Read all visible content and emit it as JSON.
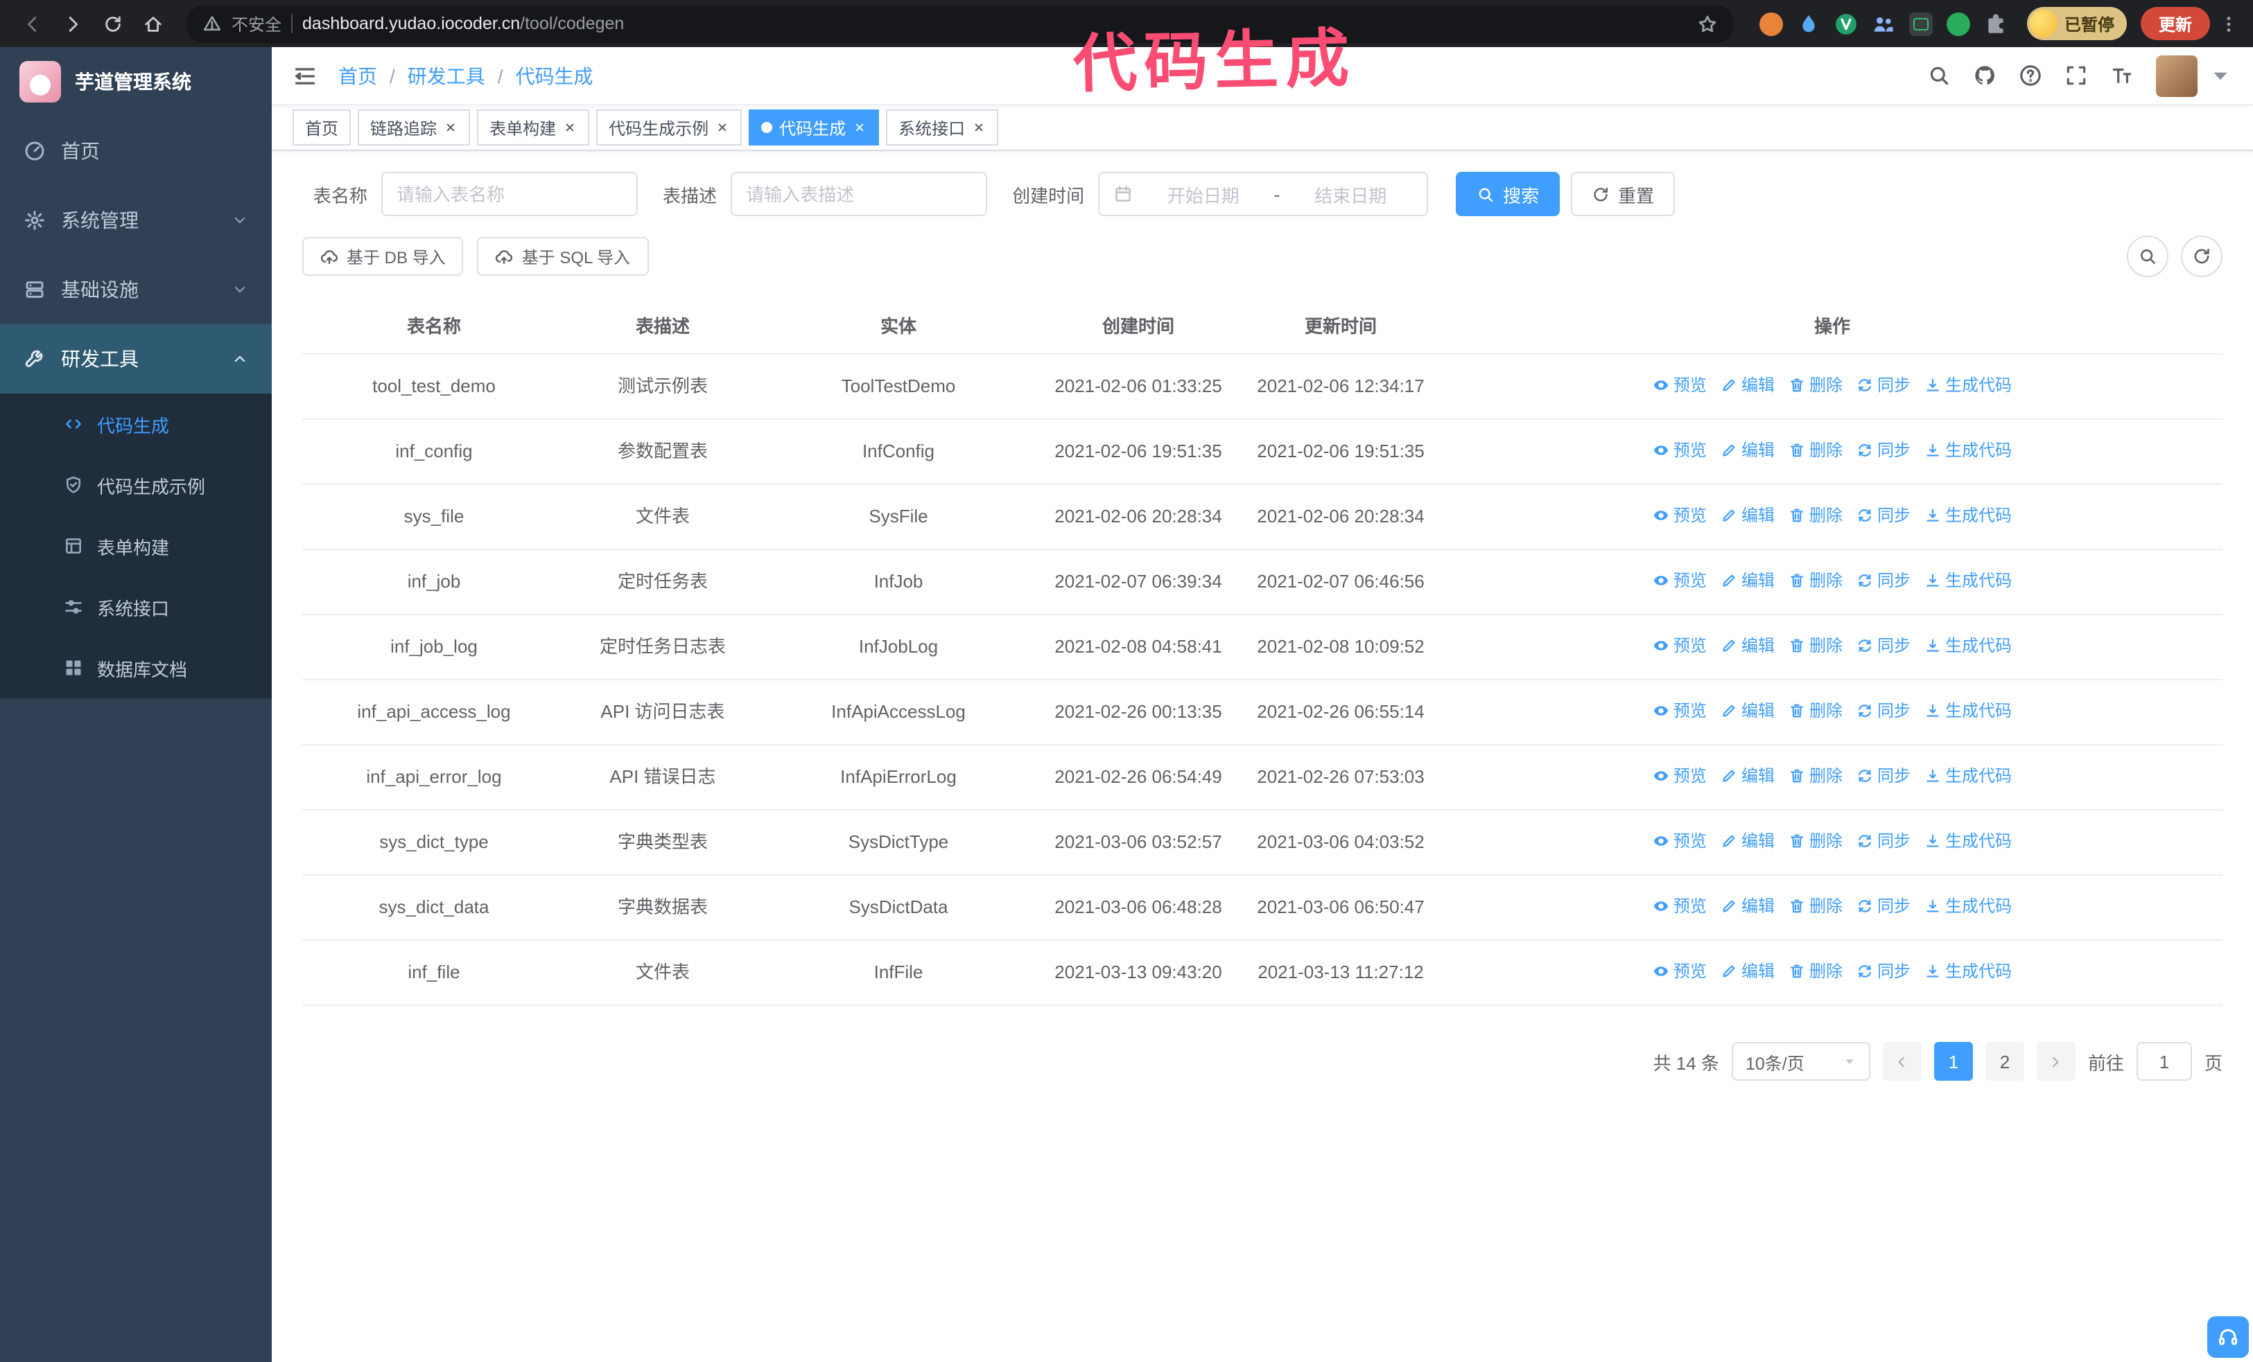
{
  "colors": {
    "accent": "#409eff",
    "annotation_pink": "#fb4d73",
    "sidebar_bg": "#304156",
    "submenu_bg": "#1f2d3d",
    "update_button_red": "#d24939",
    "chrome_bg": "#202124"
  },
  "annotation": {
    "text": "代码生成"
  },
  "browser": {
    "security_label": "不安全",
    "url_host": "dashboard.yudao.iocoder.cn",
    "url_path": "/tool/codegen",
    "paused_badge": "已暂停",
    "update_button": "更新"
  },
  "sidebar": {
    "logo_title": "芋道管理系统",
    "items": [
      {
        "label": "首页"
      },
      {
        "label": "系统管理"
      },
      {
        "label": "基础设施"
      },
      {
        "label": "研发工具"
      }
    ],
    "subitems": [
      {
        "label": "代码生成"
      },
      {
        "label": "代码生成示例"
      },
      {
        "label": "表单构建"
      },
      {
        "label": "系统接口"
      },
      {
        "label": "数据库文档"
      }
    ]
  },
  "navbar": {
    "breadcrumb": [
      "首页",
      "研发工具",
      "代码生成"
    ]
  },
  "tags": [
    {
      "label": "首页"
    },
    {
      "label": "链路追踪"
    },
    {
      "label": "表单构建"
    },
    {
      "label": "代码生成示例"
    },
    {
      "label": "代码生成"
    },
    {
      "label": "系统接口"
    }
  ],
  "search": {
    "table_name_label": "表名称",
    "table_name_placeholder": "请输入表名称",
    "table_desc_label": "表描述",
    "table_desc_placeholder": "请输入表描述",
    "create_time_label": "创建时间",
    "start_date_placeholder": "开始日期",
    "range_separator": "-",
    "end_date_placeholder": "结束日期",
    "search_button": "搜索",
    "reset_button": "重置"
  },
  "toolbar": {
    "import_db": "基于 DB 导入",
    "import_sql": "基于 SQL 导入"
  },
  "table": {
    "columns": [
      "表名称",
      "表描述",
      "实体",
      "创建时间",
      "更新时间",
      "操作"
    ],
    "actions": [
      "预览",
      "编辑",
      "删除",
      "同步",
      "生成代码"
    ],
    "rows": [
      {
        "name": "tool_test_demo",
        "desc": "测试示例表",
        "entity": "ToolTestDemo",
        "created": "2021-02-06 01:33:25",
        "updated": "2021-02-06 12:34:17"
      },
      {
        "name": "inf_config",
        "desc": "参数配置表",
        "entity": "InfConfig",
        "created": "2021-02-06 19:51:35",
        "updated": "2021-02-06 19:51:35"
      },
      {
        "name": "sys_file",
        "desc": "文件表",
        "entity": "SysFile",
        "created": "2021-02-06 20:28:34",
        "updated": "2021-02-06 20:28:34"
      },
      {
        "name": "inf_job",
        "desc": "定时任务表",
        "entity": "InfJob",
        "created": "2021-02-07 06:39:34",
        "updated": "2021-02-07 06:46:56"
      },
      {
        "name": "inf_job_log",
        "desc": "定时任务日志表",
        "entity": "InfJobLog",
        "created": "2021-02-08 04:58:41",
        "updated": "2021-02-08 10:09:52"
      },
      {
        "name": "inf_api_access_log",
        "desc": "API 访问日志表",
        "entity": "InfApiAccessLog",
        "created": "2021-02-26 00:13:35",
        "updated": "2021-02-26 06:55:14"
      },
      {
        "name": "inf_api_error_log",
        "desc": "API 错误日志",
        "entity": "InfApiErrorLog",
        "created": "2021-02-26 06:54:49",
        "updated": "2021-02-26 07:53:03"
      },
      {
        "name": "sys_dict_type",
        "desc": "字典类型表",
        "entity": "SysDictType",
        "created": "2021-03-06 03:52:57",
        "updated": "2021-03-06 04:03:52"
      },
      {
        "name": "sys_dict_data",
        "desc": "字典数据表",
        "entity": "SysDictData",
        "created": "2021-03-06 06:48:28",
        "updated": "2021-03-06 06:50:47"
      },
      {
        "name": "inf_file",
        "desc": "文件表",
        "entity": "InfFile",
        "created": "2021-03-13 09:43:20",
        "updated": "2021-03-13 11:27:12"
      }
    ]
  },
  "pagination": {
    "total": "共 14 条",
    "page_size": "10条/页",
    "pages": [
      "1",
      "2"
    ],
    "goto_label": "前往",
    "goto_value": "1",
    "page_unit": "页"
  }
}
